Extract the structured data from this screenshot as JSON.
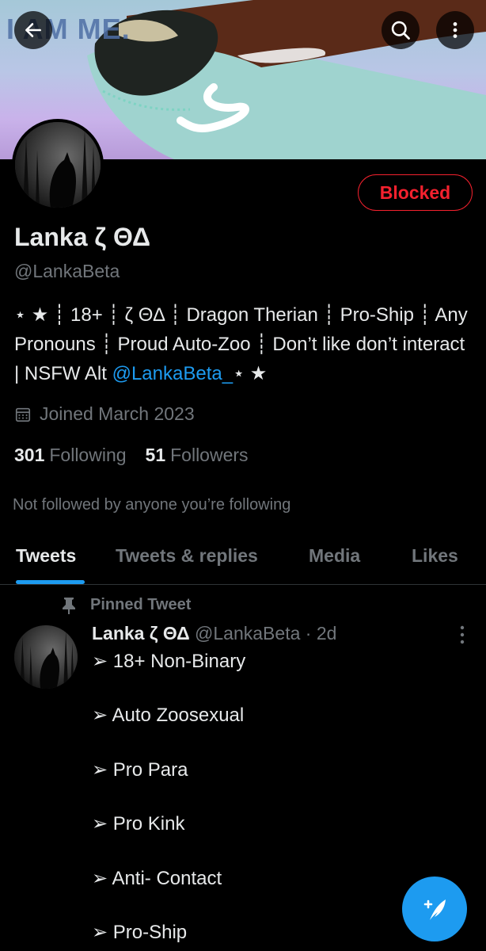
{
  "banner": {
    "text": "I AM ME."
  },
  "header": {
    "back_icon": "arrow-left-icon",
    "search_icon": "search-icon",
    "more_icon": "more-vertical-icon"
  },
  "profile": {
    "blocked_label": "Blocked",
    "display_name": "Lanka ζ ΘΔ",
    "handle": "@LankaBeta",
    "bio_before_link": "⋆ ★ ┊ 18+ ┊ ζ ΘΔ ┊ Dragon Therian ┊ Pro-Ship ┊ Any Pronouns ┊ Proud Auto-Zoo ┊ Don’t like don’t interact | NSFW Alt ",
    "bio_link": "@LankaBeta_",
    "bio_after_link": "⋆ ★",
    "joined": "Joined March 2023",
    "following_count": "301",
    "following_label": "Following",
    "followers_count": "51",
    "followers_label": "Followers",
    "not_followed_text": "Not followed by anyone you’re following"
  },
  "tabs": [
    "Tweets",
    "Tweets & replies",
    "Media",
    "Likes"
  ],
  "pinned_tweet": {
    "pinned_label": "Pinned Tweet",
    "author_name": "Lanka ζ ΘΔ",
    "author_handle": "@LankaBeta",
    "time": "· 2d",
    "lines": [
      "➢ 18+ Non-Binary",
      "➢ Auto Zoosexual",
      "➢ Pro Para",
      "➢ Pro Kink",
      "➢ Anti- Contact",
      "➢ Pro-Ship"
    ]
  },
  "compose": {
    "icon": "compose-feather-icon"
  },
  "colors": {
    "accent": "#1d9bf0",
    "blocked": "#f4212e",
    "muted": "#71767b",
    "text": "#e7e9ea"
  }
}
